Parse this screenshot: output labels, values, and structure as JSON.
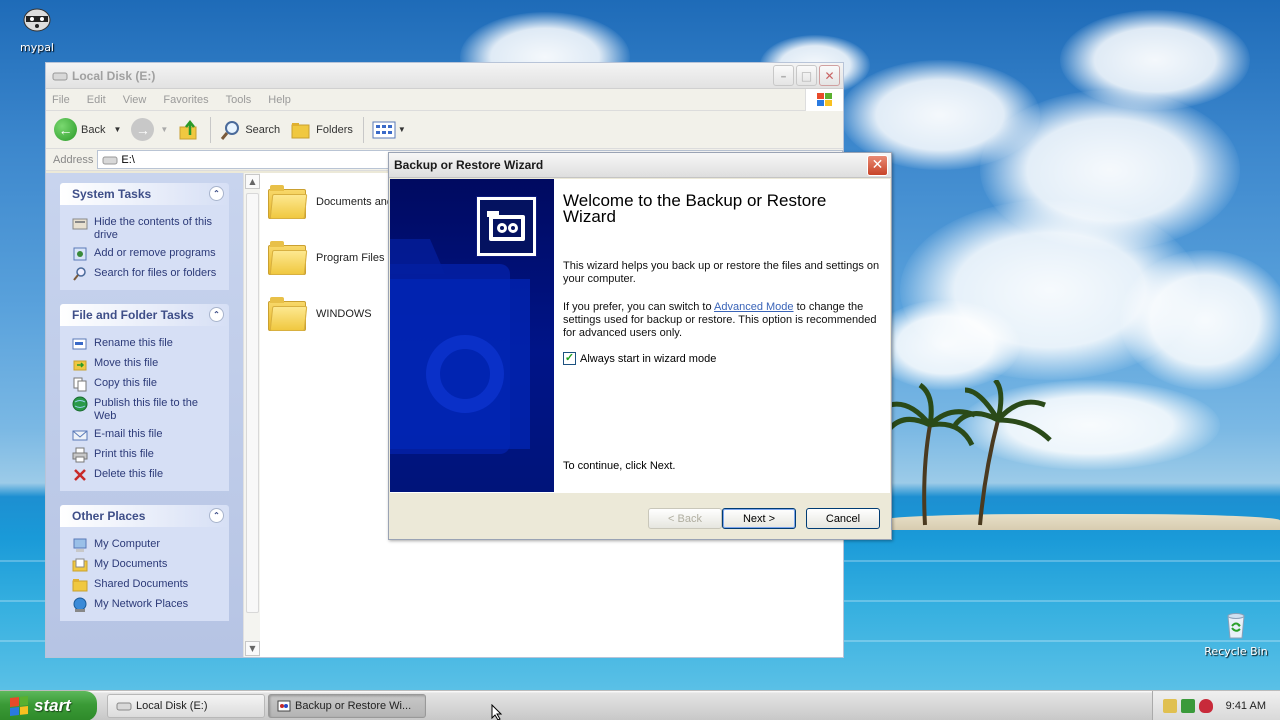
{
  "desktop": {
    "icons": [
      {
        "label": "mypal"
      },
      {
        "label": "Recycle Bin"
      }
    ]
  },
  "explorer": {
    "title": "Local Disk (E:)",
    "menu": [
      "File",
      "Edit",
      "View",
      "Favorites",
      "Tools",
      "Help"
    ],
    "toolbar": {
      "back": "Back",
      "search": "Search",
      "folders": "Folders"
    },
    "address": {
      "label": "Address",
      "value": "E:\\"
    },
    "panels": [
      {
        "title": "System Tasks",
        "items": [
          {
            "label": "Hide the contents of this drive",
            "icon": "hide-drive-icon"
          },
          {
            "label": "Add or remove programs",
            "icon": "add-remove-programs-icon"
          },
          {
            "label": "Search for files or folders",
            "icon": "search-icon"
          }
        ]
      },
      {
        "title": "File and Folder Tasks",
        "items": [
          {
            "label": "Rename this file",
            "icon": "rename-icon"
          },
          {
            "label": "Move this file",
            "icon": "move-icon"
          },
          {
            "label": "Copy this file",
            "icon": "copy-icon"
          },
          {
            "label": "Publish this file to the Web",
            "icon": "publish-web-icon"
          },
          {
            "label": "E-mail this file",
            "icon": "email-icon"
          },
          {
            "label": "Print this file",
            "icon": "print-icon"
          },
          {
            "label": "Delete this file",
            "icon": "delete-icon"
          }
        ]
      },
      {
        "title": "Other Places",
        "items": [
          {
            "label": "My Computer",
            "icon": "my-computer-icon"
          },
          {
            "label": "My Documents",
            "icon": "my-documents-icon"
          },
          {
            "label": "Shared Documents",
            "icon": "shared-documents-icon"
          },
          {
            "label": "My Network Places",
            "icon": "network-places-icon"
          }
        ]
      }
    ],
    "files": [
      "Documents and",
      "Program Files",
      "WINDOWS"
    ]
  },
  "wizard": {
    "title": "Backup or Restore Wizard",
    "heading": "Welcome to the Backup or Restore Wizard",
    "intro": "This wizard helps you back up or restore the files and settings on your computer.",
    "advanced_before": "If you prefer, you can switch to ",
    "advanced_link": "Advanced Mode",
    "advanced_after": " to change the settings used for backup or restore. This option is recommended for advanced users only.",
    "checkbox_label": "Always start in wizard mode",
    "checkbox_checked": true,
    "continue_text": "To continue, click Next.",
    "buttons": {
      "back": "< Back",
      "next": "Next >",
      "cancel": "Cancel"
    }
  },
  "taskbar": {
    "start_label": "start",
    "tasks": [
      "Local Disk (E:)",
      "Backup or Restore Wi..."
    ],
    "clock": "9:41 AM"
  },
  "colors": {
    "wizard_sidebar": "#001488",
    "start_green": "#3a9a36",
    "link_blue": "#3a64b8",
    "task_text": "#2c3a78"
  }
}
